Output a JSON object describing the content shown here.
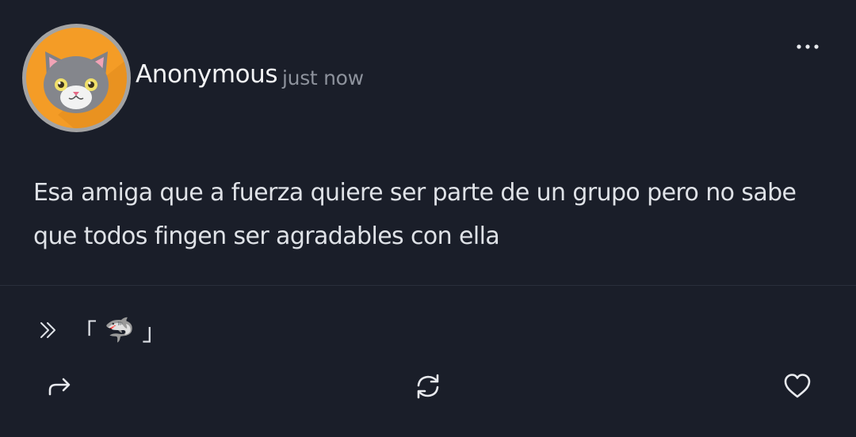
{
  "post": {
    "author": "Anonymous",
    "timestamp": "just now",
    "avatar_icon": "gray-cat-avatar",
    "avatar_bg": "#f49c26",
    "text_lines": [
      "Esa amiga que a fuerza quiere ser parte de un grupo pero no sabe",
      "que todos fingen ser agradables con ella"
    ]
  },
  "tag": {
    "icon": "double-chevron-right-icon",
    "open_bracket": "「",
    "emoji": "🦈",
    "close_bracket": "」"
  },
  "actions": {
    "more": "more-dots-icon",
    "share": "share-arrow-icon",
    "repost": "repost-icon",
    "like": "heart-icon"
  },
  "colors": {
    "background": "#1a1e29",
    "text": "#dfe2e7",
    "muted": "#8d929c"
  }
}
